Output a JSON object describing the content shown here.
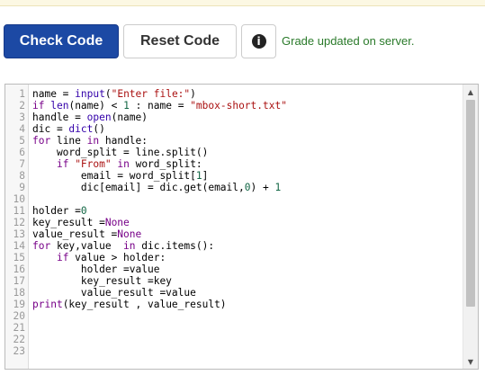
{
  "toolbar": {
    "check_label": "Check Code",
    "reset_label": "Reset Code",
    "info_icon": "info-circle-icon",
    "status": "Grade updated on server."
  },
  "colors": {
    "primary": "#1c49a4",
    "status_text": "#2a7a2a",
    "keyword": "#770088",
    "builtin": "#3300aa",
    "string": "#aa1111",
    "number": "#116644"
  },
  "editor": {
    "lines": [
      [
        {
          "t": "name = "
        },
        {
          "t": "input",
          "c": "bi"
        },
        {
          "t": "("
        },
        {
          "t": "\"Enter file:\"",
          "c": "str"
        },
        {
          "t": ")"
        }
      ],
      [
        {
          "t": "if",
          "c": "kw"
        },
        {
          "t": " "
        },
        {
          "t": "len",
          "c": "bi"
        },
        {
          "t": "(name) < "
        },
        {
          "t": "1",
          "c": "num"
        },
        {
          "t": " : name = "
        },
        {
          "t": "\"mbox-short.txt\"",
          "c": "str"
        }
      ],
      [
        {
          "t": "handle = "
        },
        {
          "t": "open",
          "c": "bi"
        },
        {
          "t": "(name)"
        }
      ],
      [
        {
          "t": "dic = "
        },
        {
          "t": "dict",
          "c": "bi"
        },
        {
          "t": "()"
        }
      ],
      [
        {
          "t": "for",
          "c": "kw"
        },
        {
          "t": " line "
        },
        {
          "t": "in",
          "c": "kw"
        },
        {
          "t": " handle:"
        }
      ],
      [
        {
          "t": "    word_split = line.split()"
        }
      ],
      [
        {
          "t": "    "
        },
        {
          "t": "if",
          "c": "kw"
        },
        {
          "t": " "
        },
        {
          "t": "\"From\"",
          "c": "str"
        },
        {
          "t": " "
        },
        {
          "t": "in",
          "c": "kw"
        },
        {
          "t": " word_split:"
        }
      ],
      [
        {
          "t": "        email = word_split["
        },
        {
          "t": "1",
          "c": "num"
        },
        {
          "t": "]"
        }
      ],
      [
        {
          "t": "        dic[email] = dic.get(email,"
        },
        {
          "t": "0",
          "c": "num"
        },
        {
          "t": ") + "
        },
        {
          "t": "1",
          "c": "num"
        }
      ],
      [],
      [
        {
          "t": "holder ="
        },
        {
          "t": "0",
          "c": "num"
        }
      ],
      [
        {
          "t": "key_result ="
        },
        {
          "t": "None",
          "c": "kw"
        }
      ],
      [
        {
          "t": "value_result ="
        },
        {
          "t": "None",
          "c": "kw"
        }
      ],
      [
        {
          "t": "for",
          "c": "kw"
        },
        {
          "t": " key,value  "
        },
        {
          "t": "in",
          "c": "kw"
        },
        {
          "t": " dic.items():"
        }
      ],
      [
        {
          "t": "    "
        },
        {
          "t": "if",
          "c": "kw"
        },
        {
          "t": " value > holder:"
        }
      ],
      [
        {
          "t": "        holder =value"
        }
      ],
      [
        {
          "t": "        key_result =key"
        }
      ],
      [
        {
          "t": "        value_result =value"
        }
      ],
      [
        {
          "t": "print",
          "c": "kw"
        },
        {
          "t": "(key_result , value_result)"
        }
      ],
      [],
      [],
      [],
      []
    ],
    "scroll_up_icon": "triangle-up-icon",
    "scroll_down_icon": "triangle-down-icon"
  }
}
